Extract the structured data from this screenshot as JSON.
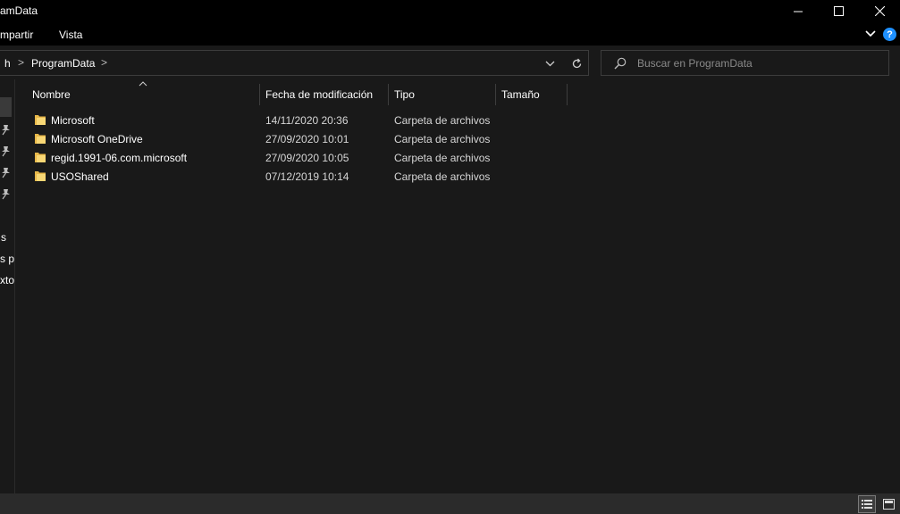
{
  "window": {
    "title": "amData",
    "minimize_icon": "minimize-icon",
    "maximize_icon": "maximize-icon",
    "close_icon": "close-icon"
  },
  "ribbon": {
    "tabs": [
      {
        "label": "mpartir"
      },
      {
        "label": "Vista"
      }
    ],
    "help_label": "?"
  },
  "address": {
    "crumbs": [
      {
        "label": "h"
      },
      {
        "label": "ProgramData"
      }
    ],
    "separator": ">",
    "search_placeholder": "Buscar en ProgramData"
  },
  "navpane": {
    "items": [
      {
        "label": "s"
      },
      {
        "label": "s pa"
      },
      {
        "label": "xto"
      }
    ]
  },
  "columns": {
    "name": "Nombre",
    "modified": "Fecha de modificación",
    "type": "Tipo",
    "size": "Tamaño"
  },
  "files": [
    {
      "name": "Microsoft",
      "modified": "14/11/2020 20:36",
      "type": "Carpeta de archivos",
      "size": ""
    },
    {
      "name": "Microsoft OneDrive",
      "modified": "27/09/2020 10:01",
      "type": "Carpeta de archivos",
      "size": ""
    },
    {
      "name": "regid.1991-06.com.microsoft",
      "modified": "27/09/2020 10:05",
      "type": "Carpeta de archivos",
      "size": ""
    },
    {
      "name": "USOShared",
      "modified": "07/12/2019 10:14",
      "type": "Carpeta de archivos",
      "size": ""
    }
  ],
  "colors": {
    "background": "#191919",
    "titlebar": "#000000",
    "folder": "#f8d775",
    "accent": "#1e90ff"
  }
}
